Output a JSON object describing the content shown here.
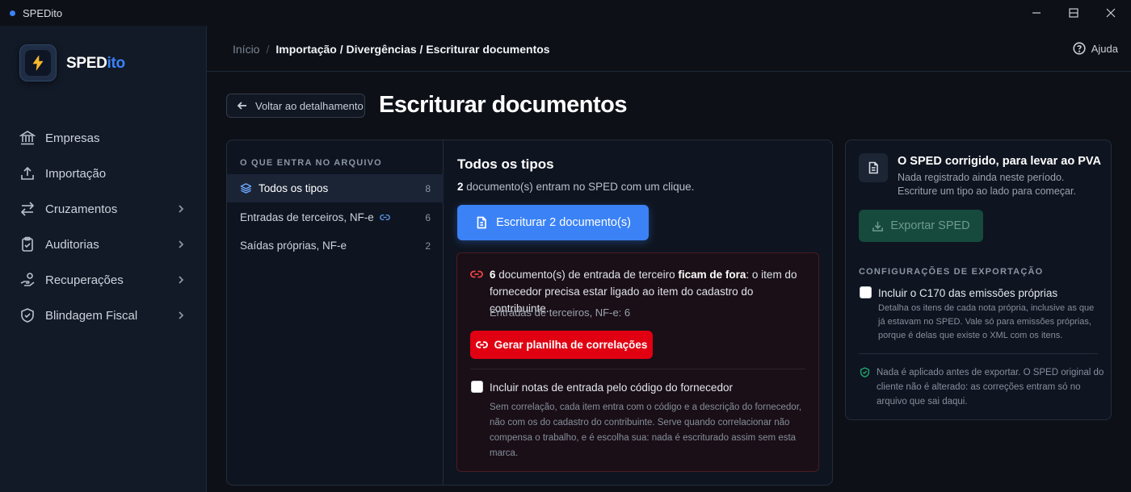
{
  "window": {
    "title": "SPEDito"
  },
  "brand": {
    "part1": "SPED",
    "part2": "ito"
  },
  "sidebar": {
    "items": [
      {
        "label": "Empresas"
      },
      {
        "label": "Importação"
      },
      {
        "label": "Cruzamentos"
      },
      {
        "label": "Auditorias"
      },
      {
        "label": "Recuperações"
      },
      {
        "label": "Blindagem Fiscal"
      }
    ]
  },
  "header": {
    "breadcrumb_home": "Início",
    "breadcrumb_sep": "/",
    "breadcrumb_current": "Importação / Divergências / Escriturar documentos",
    "help_label": "Ajuda"
  },
  "page": {
    "back_label": "Voltar ao detalhamento",
    "title": "Escriturar documentos"
  },
  "types": {
    "section_label": "O QUE ENTRA NO ARQUIVO",
    "items": [
      {
        "label": "Todos os tipos",
        "count": "8"
      },
      {
        "label": "Entradas de terceiros, NF-e",
        "count": "6"
      },
      {
        "label": "Saídas próprias, NF-e",
        "count": "2"
      }
    ]
  },
  "content": {
    "title": "Todos os tipos",
    "count": "2",
    "subtitle_rest": " documento(s) entram no SPED com um clique.",
    "primary_button": "Escriturar 2 documento(s)"
  },
  "warning": {
    "count": "6",
    "text_a": " documento(s) de entrada de terceiro ",
    "text_bold": "ficam de fora",
    "text_b": ": o item do fornecedor precisa estar ligado ao item do cadastro do contribuinte.",
    "sub": "Entradas de terceiros, NF-e: 6",
    "button": "Gerar planilha de correlações",
    "checkbox_label": "Incluir notas de entrada pelo código do fornecedor",
    "checkbox_desc": "Sem correlação, cada item entra com o código e a descrição do fornecedor, não com os do cadastro do contribuinte. Serve quando correlacionar não compensa o trabalho, e é escolha sua: nada é escriturado assim sem esta marca."
  },
  "export_panel": {
    "title": "O SPED corrigido, para levar ao PVA",
    "subtitle": "Nada registrado ainda neste período. Escriture um tipo ao lado para começar.",
    "export_button": "Exportar SPED",
    "section_label": "CONFIGURAÇÕES DE EXPORTAÇÃO",
    "checkbox_label": "Incluir o C170 das emissões próprias",
    "checkbox_desc": "Detalha os itens de cada nota própria, inclusive as que já estavam no SPED. Vale só para emissões próprias, porque é delas que existe o XML com os itens.",
    "note": "Nada é aplicado antes de exportar. O SPED original do cliente não é alterado: as correções entram só no arquivo que sai daqui."
  },
  "colors": {
    "accent": "#3b82f6",
    "danger": "#e00012",
    "success": "#22a06b"
  }
}
